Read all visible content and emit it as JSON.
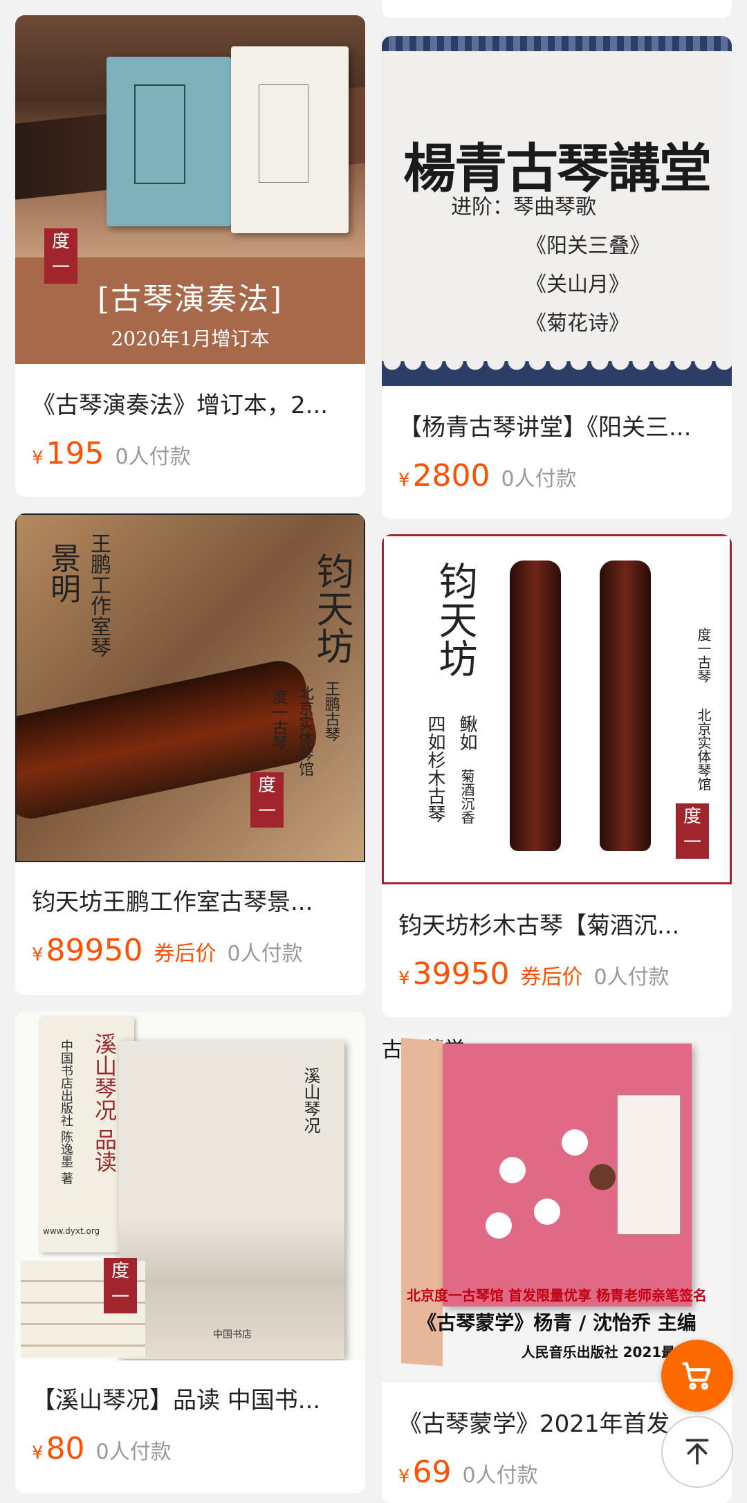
{
  "products": [
    {
      "title": "《古琴演奏法》增订本，2...",
      "price": "195",
      "coupon": "",
      "paid": "0人付款",
      "image": {
        "band_title": "[古琴演奏法]",
        "band_sub": "2020年1月增订本",
        "seal": "度一"
      }
    },
    {
      "title": "【杨青古琴讲堂】《阳关三...",
      "price": "2800",
      "coupon": "",
      "paid": "0人付款",
      "image": {
        "heading": "楊青古琴講堂",
        "line1": "进阶：琴曲琴歌",
        "line2": "《阳关三叠》",
        "line3": "《关山月》",
        "line4": "《菊花诗》"
      }
    },
    {
      "title": "钧天坊王鹏工作室古琴景...",
      "price": "89950",
      "coupon": "券后价",
      "paid": "0人付款",
      "image": {
        "big": "钧天坊",
        "left1": "景明",
        "left2": "王鹏工作室琴",
        "right1": "王鹏古琴",
        "right2": "北京实体琴馆",
        "right3": "度一古琴",
        "seal": "度一"
      }
    },
    {
      "title": "钧天坊杉木古琴【菊酒沉...",
      "price": "39950",
      "coupon": "券后价",
      "paid": "0人付款",
      "image": {
        "big": "钧天坊",
        "sub1": "四如杉木古琴",
        "sub2": "鳅如",
        "sub3": "菊酒沉香",
        "right1": "度一古琴",
        "right2": "北京实体琴馆",
        "seal": "度一"
      }
    },
    {
      "title": "【溪山琴况】品读 中国书...",
      "price": "80",
      "coupon": "",
      "paid": "0人付款",
      "image": {
        "spine_title": "溪山琴况 品读",
        "spine_pub": "中国书店出版社 陈逸墨 著",
        "url": "www.dyxt.org",
        "cover_title": "溪山琴况",
        "seal": "度一",
        "cover_pub": "中国书店"
      }
    },
    {
      "title": "《古琴蒙学》2021年首发",
      "price": "69",
      "coupon": "",
      "paid": "0人付款",
      "image": {
        "cover_title": "古琴蒙学",
        "cap1": "北京度一古琴馆 首发限量优享 杨青老师亲笔签名",
        "cap2": "《古琴蒙学》杨青 / 沈怡乔 主编",
        "cap3": "人民音乐出版社 2021最"
      }
    }
  ],
  "currency": "¥",
  "colors": {
    "accent": "#ff5000",
    "bg": "#f2f2f2"
  },
  "icons": {
    "cart": "cart-icon",
    "top": "back-to-top-icon"
  }
}
